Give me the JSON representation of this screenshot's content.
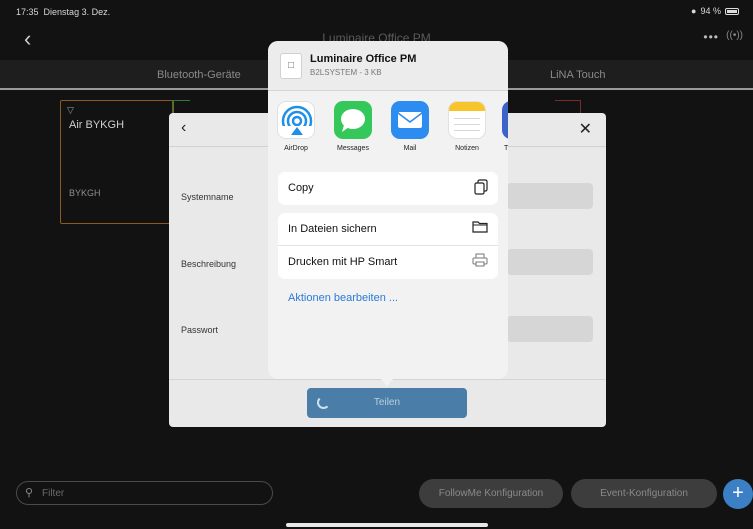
{
  "status": {
    "time": "17:35",
    "date": "Dienstag 3. Dez.",
    "battery": "94 %"
  },
  "nav": {
    "title": "Luminaire Office PM"
  },
  "tabs": [
    {
      "label": "Bluetooth-Geräte"
    },
    {
      "label": "LiNA Touch"
    }
  ],
  "device": {
    "name": "Air BYKGH",
    "id": "BYKGH"
  },
  "modal": {
    "fields": [
      {
        "label": "Systemname"
      },
      {
        "label": "Beschreibung"
      },
      {
        "label": "Passwort"
      }
    ],
    "share_button": "Teilen"
  },
  "share_sheet": {
    "file_name": "Luminaire Office PM",
    "file_meta": "B2LSYSTEM - 3 KB",
    "apps": [
      {
        "label": "AirDrop",
        "icon": "airdrop-icon"
      },
      {
        "label": "Messages",
        "icon": "messages-icon"
      },
      {
        "label": "Mail",
        "icon": "mail-icon"
      },
      {
        "label": "Notizen",
        "icon": "notes-icon"
      },
      {
        "label": "T",
        "icon": "app-icon-partial"
      }
    ],
    "actions_group1": [
      {
        "label": "Copy",
        "icon": "copy-icon"
      }
    ],
    "actions_group2": [
      {
        "label": "In Dateien sichern",
        "icon": "folder-icon"
      },
      {
        "label": "Drucken mit HP Smart",
        "icon": "printer-icon"
      }
    ],
    "edit_actions": "Aktionen bearbeiten ..."
  },
  "bottom": {
    "filter_placeholder": "Filter",
    "followme_button": "FollowMe Konfiguration",
    "event_button": "Event-Konfiguration"
  },
  "colors": {
    "accent": "#2a7ad8",
    "share_button": "#4a7ea8",
    "fab": "#3b7fc4"
  }
}
